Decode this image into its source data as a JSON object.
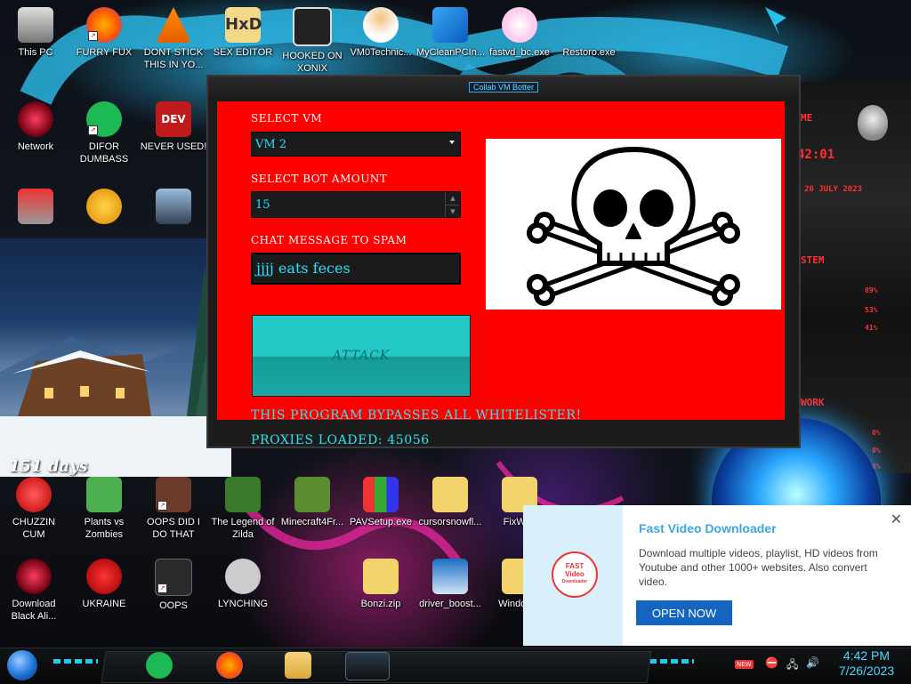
{
  "desktop": {
    "icons": [
      {
        "label": "This PC"
      },
      {
        "label": "FURRY FUX"
      },
      {
        "label": "DONT STICK\nTHIS IN YO..."
      },
      {
        "label": "SEX EDITOR"
      },
      {
        "label": "HOOKED ON\nXONIX"
      },
      {
        "label": "VM0Technic..."
      },
      {
        "label": "MyCleanPCIn..."
      },
      {
        "label": "fastvd_bc.exe"
      },
      {
        "label": "Restoro.exe"
      },
      {
        "label": "Network"
      },
      {
        "label": "DIFOR\nDUMBASS"
      },
      {
        "label": "NEVER USED!"
      },
      {
        "label": "CHUZZIN\nCUM"
      },
      {
        "label": "Plants vs\nZombies"
      },
      {
        "label": "OOPS DID I\nDO THAT"
      },
      {
        "label": "The Legend of\nZilda"
      },
      {
        "label": "Minecraft4Fr..."
      },
      {
        "label": "PAVSetup.exe"
      },
      {
        "label": "cursorsnowfl..."
      },
      {
        "label": "FixWi..."
      },
      {
        "label": "Download\nBlack Ali..."
      },
      {
        "label": "UKRAINE"
      },
      {
        "label": "OOPS"
      },
      {
        "label": "LYNCHING"
      },
      {
        "label": "Bonzi.zip"
      },
      {
        "label": "driver_boost..."
      },
      {
        "label": "Window..."
      }
    ]
  },
  "hud": {
    "time": "42:01",
    "date": "26 JULY 2023",
    "system_label": "STEM",
    "stats": [
      "89%",
      "53%",
      "41%"
    ],
    "network_label": "WORK",
    "net_stats": [
      "0%",
      "0%",
      "0%"
    ]
  },
  "app": {
    "title": "Collab VM Botter",
    "select_vm_label": "SELECT VM",
    "select_vm_value": "VM 2",
    "bot_amount_label": "SELECT BOT AMOUNT",
    "bot_amount_value": "15",
    "chat_label": "CHAT MESSAGE TO SPAM",
    "chat_value": "jjjj eats feces",
    "attack_label": "ATTACK",
    "bypass_text": "THIS PROGRAM BYPASSES ALL WHITELISTER!",
    "proxies_text": "PROXIES LOADED: 45056"
  },
  "widget": {
    "days_text": "151 days"
  },
  "toast": {
    "logo_lines": [
      "FAST",
      "Video",
      "Downloader"
    ],
    "title": "Fast Video Downloader",
    "description": "Download multiple videos, playlist, HD videos from Youtube and other 1000+ websites. Also convert video.",
    "button": "OPEN NOW",
    "close": "✕"
  },
  "taskbar": {
    "time": "4:42 PM",
    "date": "7/26/2023",
    "badge": "NEW"
  },
  "colors": {
    "accent": "#27e0ff",
    "app_bg": "#ff0000",
    "attack_bg": "#22c9c6",
    "toast_button": "#1565c0"
  }
}
